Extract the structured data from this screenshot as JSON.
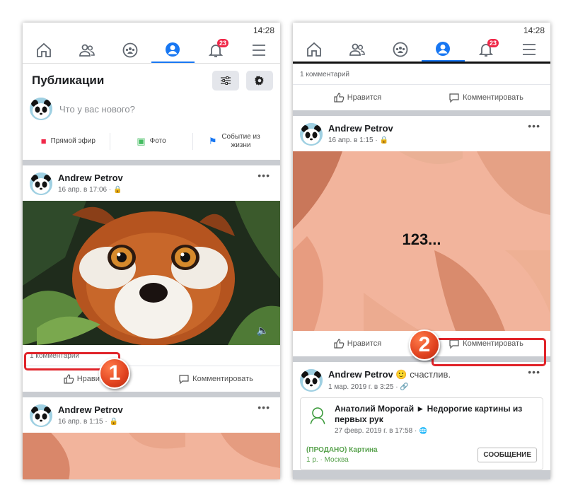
{
  "status_time": "14:28",
  "badge_count": "23",
  "left": {
    "publications_title": "Публикации",
    "composer_placeholder": "Что у вас нового?",
    "actions": [
      {
        "label": "Прямой эфир"
      },
      {
        "label": "Фото"
      },
      {
        "label": "Событие из жизни"
      }
    ],
    "post1": {
      "author": "Andrew Petrov",
      "date": "16 апр. в 17:06 ·",
      "comments_count": "1 комментарий",
      "like_label": "Нравится",
      "comment_label": "Комментировать"
    },
    "post2": {
      "author": "Andrew Petrov",
      "date": "16 апр. в 1:15 ·"
    }
  },
  "right": {
    "top": {
      "comments_count": "1 комментарий",
      "like_label": "Нравится",
      "comment_label": "Комментировать"
    },
    "post1": {
      "author": "Andrew Petrov",
      "date": "16 апр. в 1:15 ·",
      "image_text": "123...",
      "like_label": "Нравится",
      "comment_label": "Комментировать"
    },
    "post2": {
      "author": "Andrew Petrov",
      "feeling": "счастлив.",
      "date": "1 мар. 2019 г. в 3:25 ·",
      "shared_title": "Анатолий Морогай ► Недорогие картины из первых рук",
      "shared_date": "27 февр. 2019 г. в 17:58 ·",
      "sold_title": "(ПРОДАНО) Картина",
      "sold_sub": "1 р. · Москва",
      "message_button": "СООБЩЕНИЕ"
    }
  },
  "callouts": [
    "1",
    "2"
  ],
  "colors": {
    "accent": "#1877f2",
    "callout": "#e0242a",
    "badge": "#f02849"
  }
}
